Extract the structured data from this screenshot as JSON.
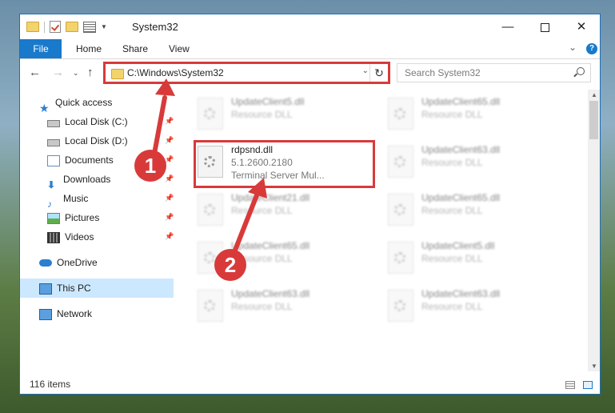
{
  "window": {
    "title": "System32",
    "minimize_glyph": "—",
    "close_glyph": "✕"
  },
  "ribbon": {
    "tabs": [
      "File",
      "Home",
      "Share",
      "View"
    ],
    "collapse_glyph": "⌄",
    "help_glyph": "?"
  },
  "nav": {
    "back_glyph": "←",
    "forward_glyph": "→",
    "recent_glyph": "⌄",
    "up_glyph": "↑",
    "address": "C:\\Windows\\System32",
    "address_dropdown_glyph": "⌄",
    "refresh_glyph": "↻",
    "search_placeholder": "Search System32"
  },
  "sidebar": {
    "items": [
      {
        "label": "Quick access",
        "icon": "star-icon"
      },
      {
        "label": "Local Disk (C:)",
        "icon": "drive-icon"
      },
      {
        "label": "Local Disk (D:)",
        "icon": "drive-icon"
      },
      {
        "label": "Documents",
        "icon": "documents-icon"
      },
      {
        "label": "Downloads",
        "icon": "downloads-icon"
      },
      {
        "label": "Music",
        "icon": "music-icon"
      },
      {
        "label": "Pictures",
        "icon": "pictures-icon"
      },
      {
        "label": "Videos",
        "icon": "videos-icon"
      },
      {
        "label": "OneDrive",
        "icon": "onedrive-icon"
      },
      {
        "label": "This PC",
        "icon": "pc-icon",
        "selected": true
      },
      {
        "label": "Network",
        "icon": "network-icon"
      }
    ],
    "pin_glyph": "📌"
  },
  "files": [
    {
      "name": "UpdateClient5.dll",
      "type": "Resource DLL"
    },
    {
      "name": "UpdateClient65.dll",
      "type": "Resource DLL"
    },
    {
      "name": "rdpsnd.dll",
      "version": "5.1.2600.2180",
      "description": "Terminal Server Mul..."
    },
    {
      "name": "UpdateClient63.dll",
      "type": "Resource DLL"
    },
    {
      "name": "UpdateClient21.dll",
      "type": "Resource DLL"
    },
    {
      "name": "UpdateClient65.dll",
      "type": "Resource DLL"
    },
    {
      "name": "UpdateClient65.dll",
      "type": "Resource DLL"
    },
    {
      "name": "UpdateClient5.dll",
      "type": "Resource DLL"
    },
    {
      "name": "UpdateClient63.dll",
      "type": "Resource DLL"
    },
    {
      "name": "UpdateClient63.dll",
      "type": "Resource DLL"
    }
  ],
  "status": {
    "count": "116 items"
  },
  "callouts": [
    "1",
    "2"
  ],
  "colors": {
    "accent": "#1979ca",
    "highlight": "#d83a3a",
    "selected": "#cce8ff"
  }
}
